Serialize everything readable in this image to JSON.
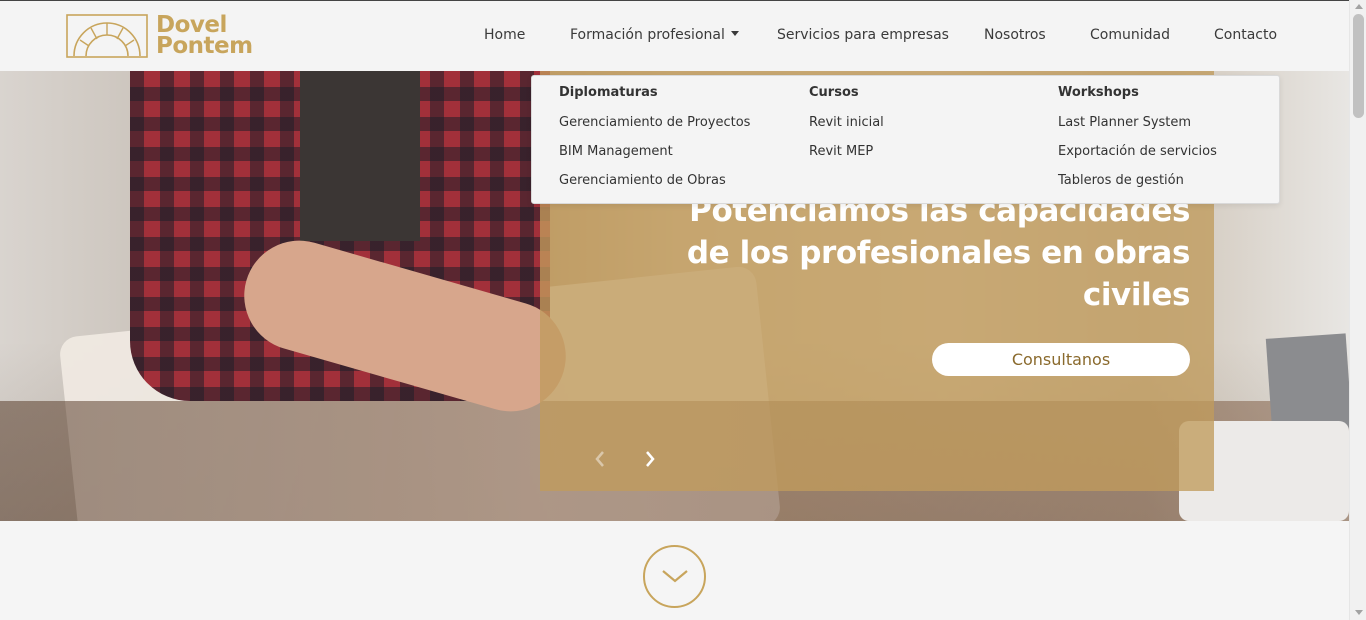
{
  "brand": {
    "name_line1": "Dovel",
    "name_line2": "Pontem",
    "accent_color": "#c8a55c",
    "logo_icon": "arch-bridge-logo-icon"
  },
  "nav": {
    "home": "Home",
    "formacion": "Formación profesional",
    "servicios": "Servicios para empresas",
    "nosotros": "Nosotros",
    "comunidad": "Comunidad",
    "contacto": "Contacto"
  },
  "dropdown": {
    "columns": [
      {
        "heading": "Diplomaturas",
        "items": [
          "Gerenciamiento de Proyectos",
          "BIM Management",
          "Gerenciamiento de Obras"
        ]
      },
      {
        "heading": "Cursos",
        "items": [
          "Revit inicial",
          "Revit MEP"
        ]
      },
      {
        "heading": "Workshops",
        "items": [
          "Last Planner System",
          "Exportación de servicios",
          "Tableros de gestión"
        ]
      }
    ]
  },
  "hero": {
    "title_line1": "Potenciamos las capacidades",
    "title_line2": "de los profesionales en obras",
    "title_line3": "civiles",
    "cta_label": "Consultanos",
    "prev_icon": "chevron-left-icon",
    "next_icon": "chevron-right-icon"
  },
  "scroll_down": {
    "icon": "chevron-down-icon"
  }
}
